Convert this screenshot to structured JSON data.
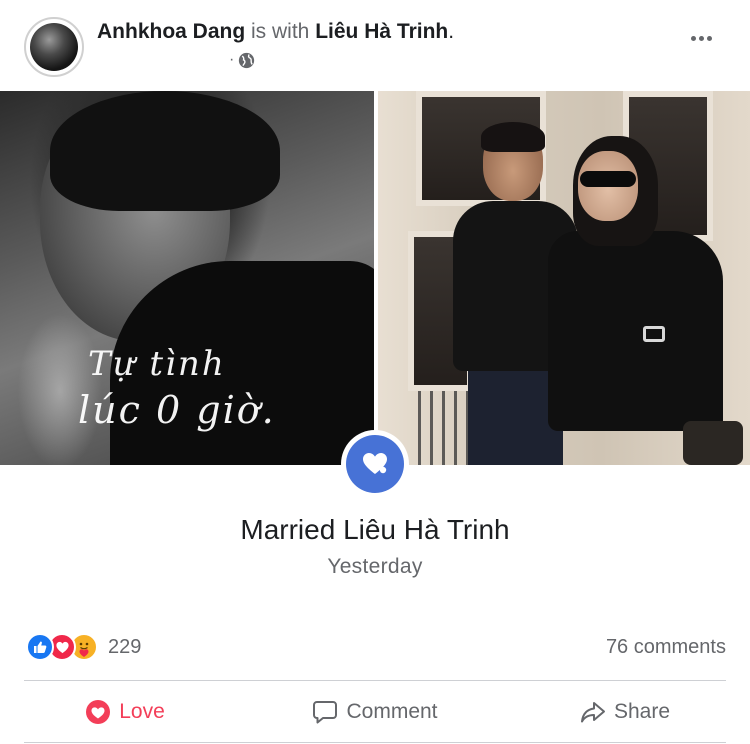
{
  "post": {
    "author": "Anhkhoa Dang",
    "with_text": "is with",
    "tagged": "Liêu Hà Trinh",
    "period": ".",
    "privacy_dot": "·",
    "privacy_icon": "globe-icon",
    "menu_icon": "more-options-icon"
  },
  "photos": {
    "left_caption": [
      "Tự tình",
      "lúc 0 giờ."
    ]
  },
  "life_event": {
    "badge_icon": "heart-icon",
    "title": "Married Liêu Hà Trinh",
    "date": "Yesterday"
  },
  "engagement": {
    "reaction_icons": [
      "like-icon",
      "love-icon",
      "care-icon"
    ],
    "reaction_count": "229",
    "comments_count": "76 comments"
  },
  "actions": {
    "love_label": "Love",
    "comment_label": "Comment",
    "share_label": "Share"
  },
  "colors": {
    "love_red": "#f33e58",
    "like_blue": "#1877f2",
    "badge_blue": "#4772d6",
    "secondary_text": "#65676b"
  }
}
